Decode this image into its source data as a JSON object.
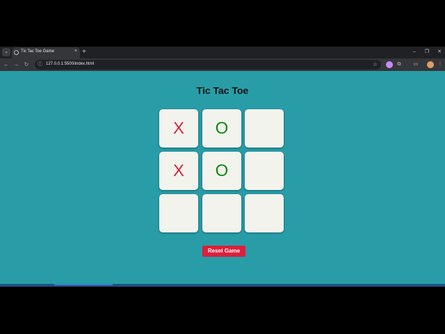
{
  "browser": {
    "tab_title": "Tic Tac Toe Game",
    "tab_close": "×",
    "new_tab": "+",
    "url": "127.0.0.1:5500/index.html",
    "tab_search_glyph": "⌄",
    "back_glyph": "←",
    "forward_glyph": "→",
    "reload_glyph": "↻",
    "site_info_glyph": "ⓘ",
    "star_glyph": "☆",
    "extensions_glyph": "⧉",
    "menu_glyph": "⋮",
    "minimize_glyph": "–",
    "restore_glyph": "❐",
    "close_glyph": "✕"
  },
  "game": {
    "title": "Tic Tac Toe",
    "board": [
      "X",
      "O",
      "",
      "X",
      "O",
      "",
      "",
      "",
      ""
    ],
    "reset_label": "Reset Game"
  },
  "colors": {
    "page_background": "#289da8",
    "x_mark": "#d3263d",
    "o_mark": "#0d8a0d",
    "reset_button": "#dc1f3b",
    "cell_background": "#f3f3ed"
  }
}
